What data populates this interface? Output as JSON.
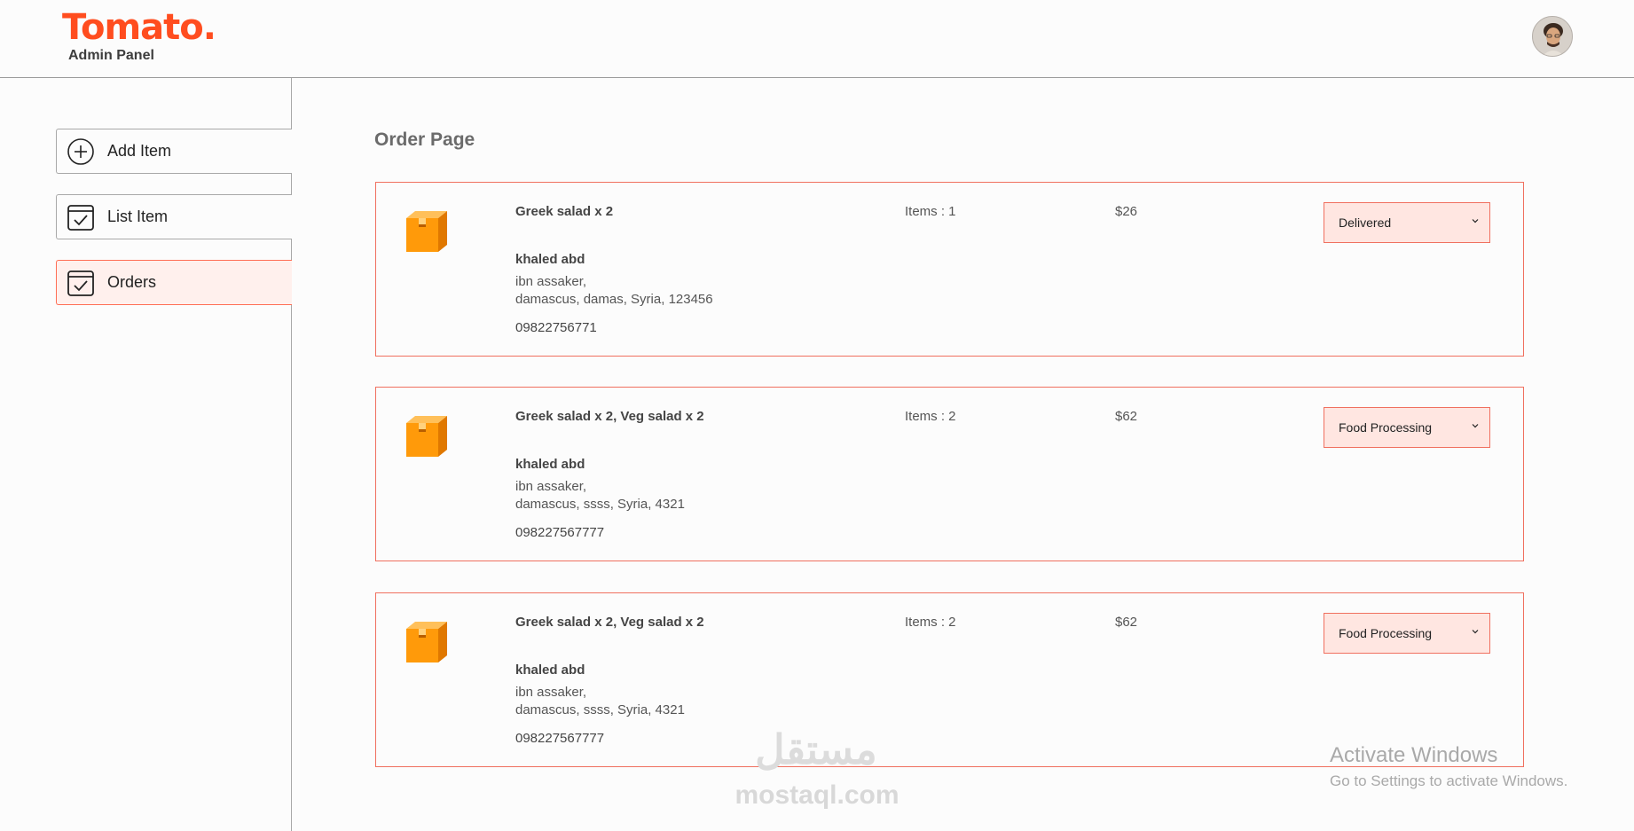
{
  "header": {
    "logo": "Tomato.",
    "subtitle": "Admin Panel"
  },
  "sidebar": {
    "items": [
      {
        "label": "Add Item",
        "icon": "add-circle-icon",
        "active": false
      },
      {
        "label": "List Item",
        "icon": "checklist-icon",
        "active": false
      },
      {
        "label": "Orders",
        "icon": "checklist-icon",
        "active": true
      }
    ]
  },
  "main": {
    "title": "Order Page",
    "orders": [
      {
        "items": "Greek salad x 2",
        "name": "khaled abd",
        "street": "ibn assaker,",
        "city": "damascus, damas, Syria, 123456",
        "phone": "09822756771",
        "count": "Items : 1",
        "amount": "$26",
        "status": "Delivered"
      },
      {
        "items": "Greek salad x 2, Veg salad x 2",
        "name": "khaled abd",
        "street": "ibn assaker,",
        "city": "damascus, ssss, Syria, 4321",
        "phone": "098227567777",
        "count": "Items : 2",
        "amount": "$62",
        "status": "Food Processing"
      },
      {
        "items": "Greek salad x 2, Veg salad x 2",
        "name": "khaled abd",
        "street": "ibn assaker,",
        "city": "damascus, ssss, Syria, 4321",
        "phone": "098227567777",
        "count": "Items : 2",
        "amount": "$62",
        "status": "Food Processing"
      }
    ]
  },
  "watermark": {
    "arabic": "مستقل",
    "text": "mostaql.com"
  },
  "os_notice": {
    "title": "Activate Windows",
    "subtitle": "Go to Settings to activate Windows."
  },
  "colors": {
    "accent": "#ff4d1f",
    "order_border": "#f0705f",
    "active_bg": "#fff0ed",
    "select_bg": "#ffe6e1",
    "parcel": "#ff9a0a"
  }
}
